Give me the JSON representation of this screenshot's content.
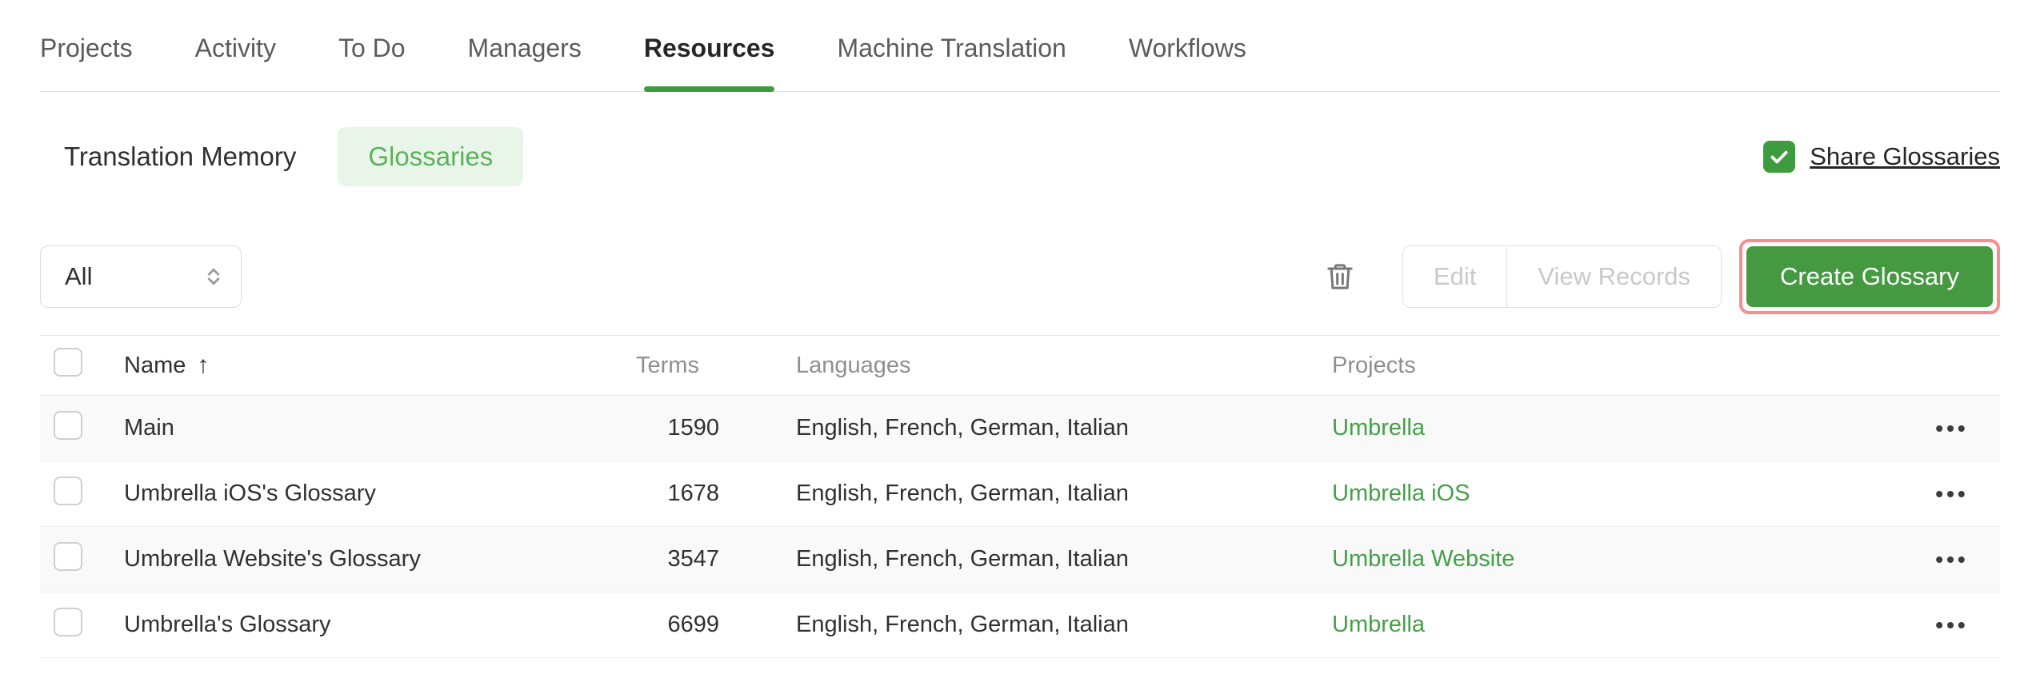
{
  "nav": {
    "tabs": [
      {
        "label": "Projects",
        "active": false
      },
      {
        "label": "Activity",
        "active": false
      },
      {
        "label": "To Do",
        "active": false
      },
      {
        "label": "Managers",
        "active": false
      },
      {
        "label": "Resources",
        "active": true
      },
      {
        "label": "Machine Translation",
        "active": false
      },
      {
        "label": "Workflows",
        "active": false
      }
    ]
  },
  "subnav": {
    "translation_memory": "Translation Memory",
    "glossaries": "Glossaries",
    "active_tab": "Glossaries",
    "share_glossaries": {
      "label": "Share Glossaries",
      "checked": true
    }
  },
  "toolbar": {
    "filter_value": "All",
    "edit": "Edit",
    "view_records": "View Records",
    "create_glossary": "Create Glossary",
    "edit_enabled": false,
    "view_records_enabled": false
  },
  "table": {
    "headers": {
      "name": "Name",
      "terms": "Terms",
      "languages": "Languages",
      "projects": "Projects"
    },
    "sort": {
      "column": "Name",
      "direction": "ascending"
    },
    "rows": [
      {
        "name": "Main",
        "terms": "1590",
        "languages": "English, French, German, Italian",
        "project": "Umbrella"
      },
      {
        "name": "Umbrella iOS's Glossary",
        "terms": "1678",
        "languages": "English, French, German, Italian",
        "project": "Umbrella iOS"
      },
      {
        "name": "Umbrella Website's Glossary",
        "terms": "3547",
        "languages": "English, French, German, Italian",
        "project": "Umbrella Website"
      },
      {
        "name": "Umbrella's Glossary",
        "terms": "6699",
        "languages": "English, French, German, Italian",
        "project": "Umbrella"
      }
    ]
  },
  "icons": {
    "sort_arrow": "↑",
    "row_menu": "•••",
    "trash": "trash-icon",
    "select_arrows": "up-down-chevrons-icon",
    "checkmark": "check-icon"
  },
  "colors": {
    "accent_green": "#3E9C3E",
    "button_green": "#459A41",
    "pill_background": "#E9F5E9",
    "pill_text": "#5CB25C",
    "link_green": "#43A047",
    "highlight_red": "#F29090",
    "disabled_text": "#C9C9C9",
    "header_text": "#8F8F8F"
  }
}
